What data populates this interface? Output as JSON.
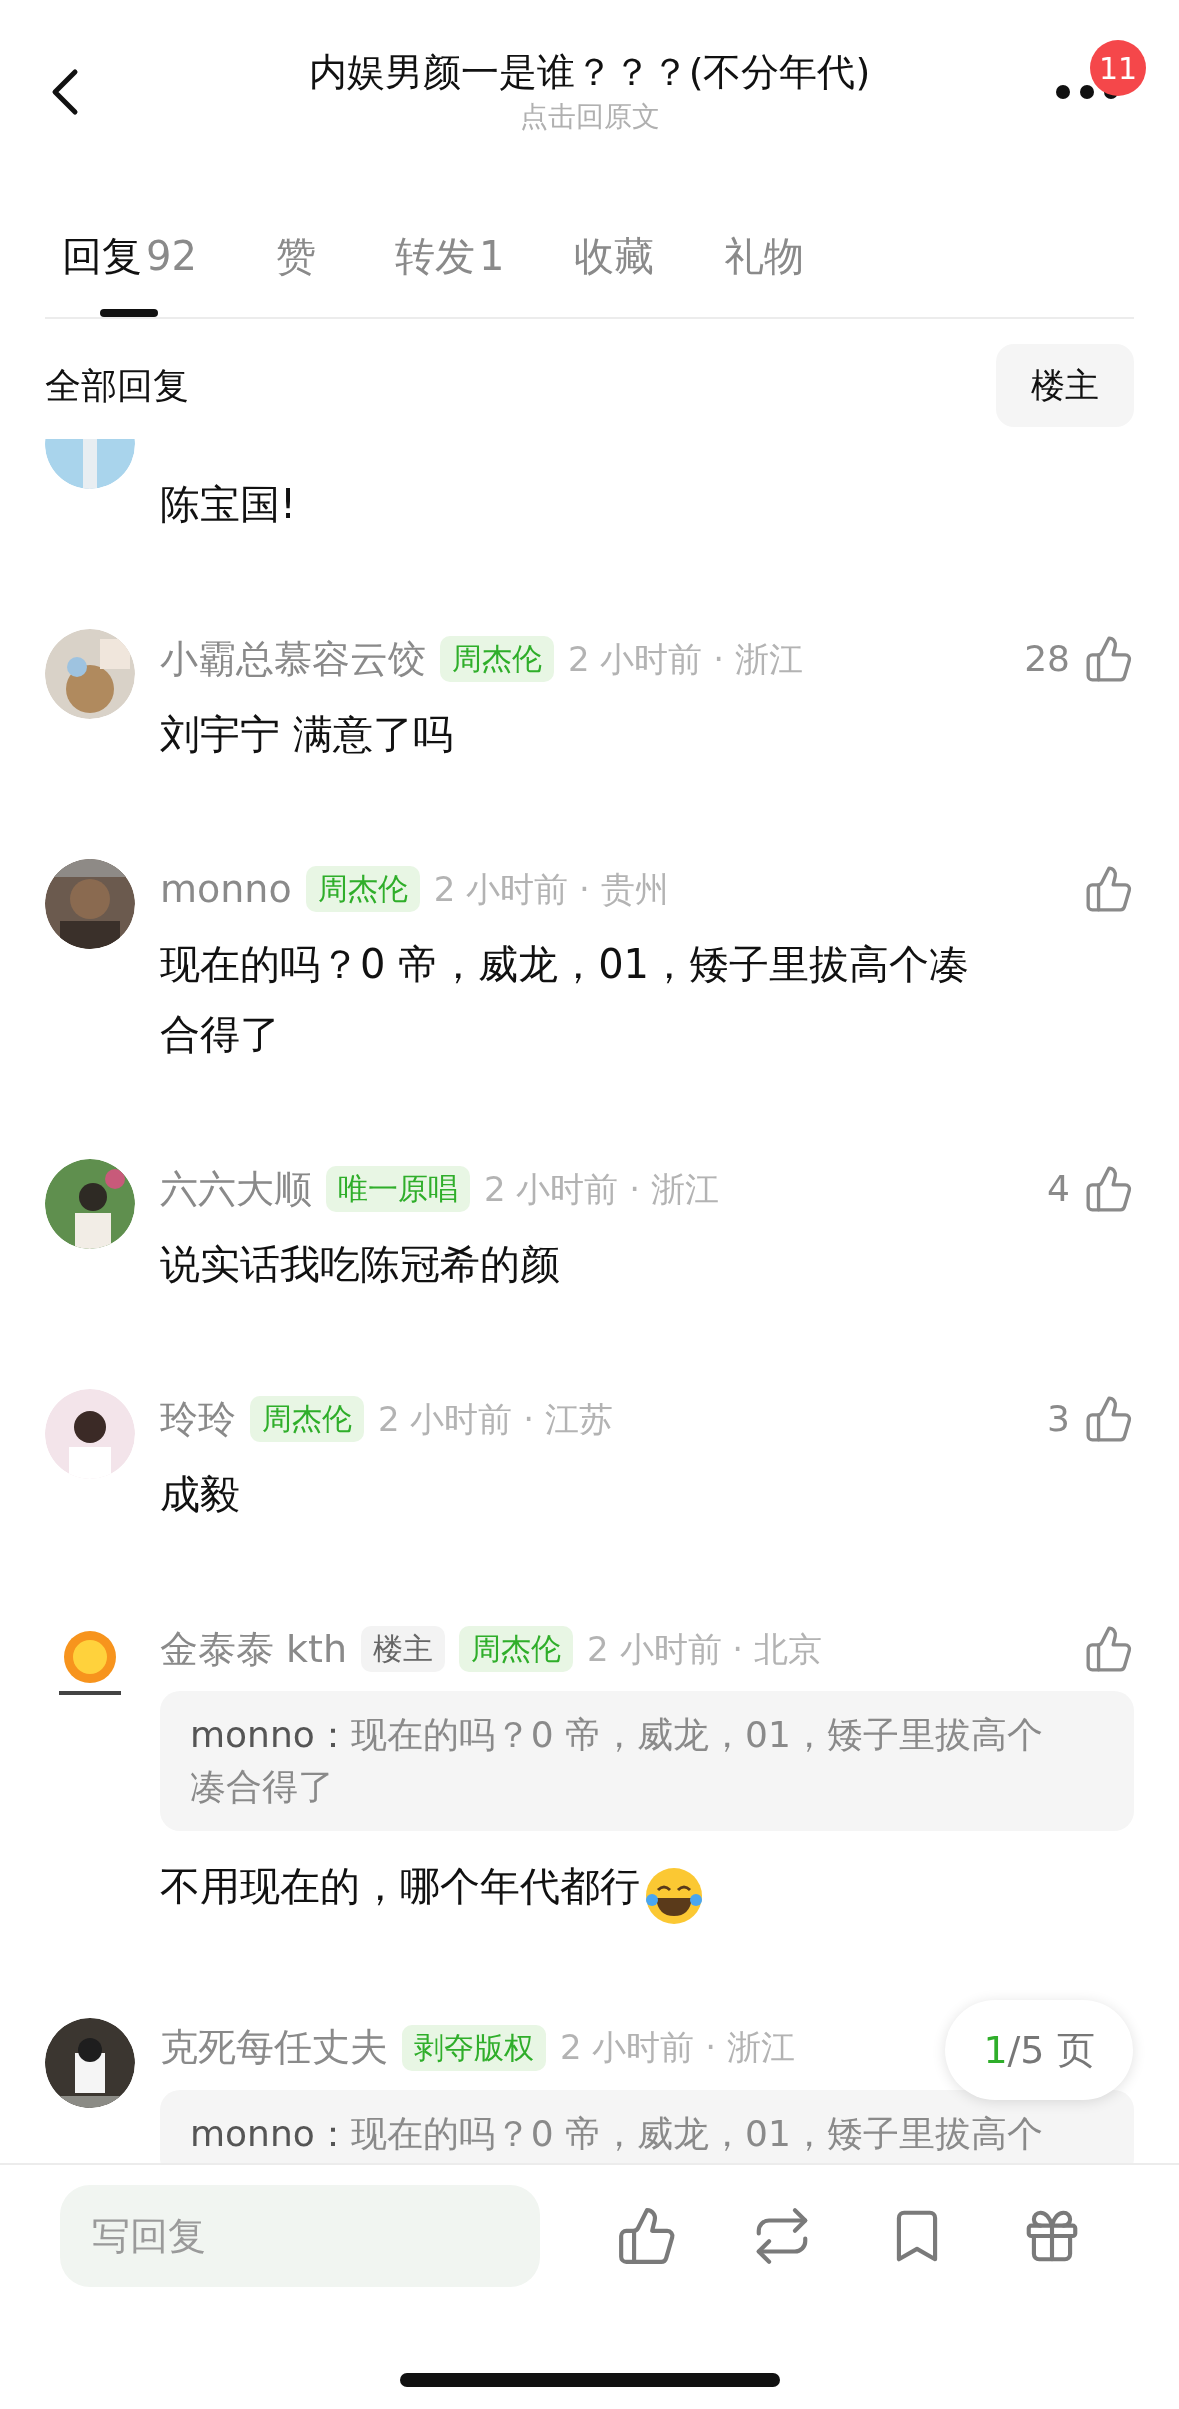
{
  "header": {
    "title": "内娱男颜一是谁？？？(不分年代)",
    "subtitle": "点击回原文",
    "badge": "11"
  },
  "tabs": [
    {
      "label": "回复",
      "count": "92",
      "selected": true
    },
    {
      "label": "赞",
      "selected": false
    },
    {
      "label": "转发",
      "count": "1",
      "selected": false
    },
    {
      "label": "收藏",
      "selected": false
    },
    {
      "label": "礼物",
      "selected": false
    }
  ],
  "section": {
    "title": "全部回复",
    "filter_button": "楼主"
  },
  "comments": [
    {
      "content": "陈宝国!",
      "partial": true
    },
    {
      "name": "小霸总慕容云饺",
      "tags": [
        {
          "kind": "fan",
          "label": "周杰伦"
        }
      ],
      "meta": "2 小时前 · 浙江",
      "likes": "28",
      "content": "刘宇宁 满意了吗"
    },
    {
      "name": "monno",
      "tags": [
        {
          "kind": "fan",
          "label": "周杰伦"
        }
      ],
      "meta": "2 小时前 · 贵州",
      "content": "现在的吗？0 帝，威龙，01，矮子里拔高个凑合得了"
    },
    {
      "name": "六六大顺",
      "tags": [
        {
          "kind": "fan",
          "label": "唯一原唱"
        }
      ],
      "meta": "2 小时前 · 浙江",
      "likes": "4",
      "content": "说实话我吃陈冠希的颜"
    },
    {
      "name": "玲玲",
      "tags": [
        {
          "kind": "fan",
          "label": "周杰伦"
        }
      ],
      "meta": "2 小时前 · 江苏",
      "likes": "3",
      "content": "成毅"
    },
    {
      "name": "金泰泰 kth",
      "tags": [
        {
          "kind": "owner",
          "label": "楼主"
        },
        {
          "kind": "fan",
          "label": "周杰伦"
        }
      ],
      "meta": "2 小时前 · 北京",
      "quote": {
        "author": "monno：",
        "text": "现在的吗？0 帝，威龙，01，矮子里拔高个凑合得了"
      },
      "content": "不用现在的，哪个年代都行",
      "laugh_emoji": true
    },
    {
      "name": "克死每任丈夫",
      "tags": [
        {
          "kind": "fan",
          "label": "剥夺版权"
        }
      ],
      "meta": "2 小时前 · 浙江",
      "like_covered": true,
      "quote": {
        "author": "monno：",
        "text": "现在的吗？0 帝，威龙，01，矮子里拔高个"
      }
    }
  ],
  "pager": {
    "current": "1",
    "rest": "/5 页"
  },
  "reply_field": {
    "placeholder": "写回复"
  }
}
